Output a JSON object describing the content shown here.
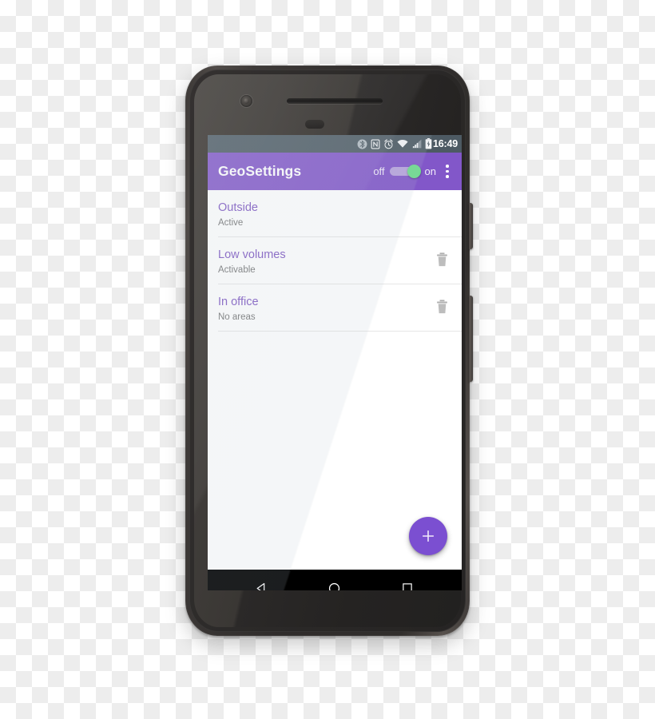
{
  "device": {
    "name": "android-smartphone",
    "hardware": {
      "front_camera": "front-camera",
      "earpiece": "earpiece-speaker",
      "proximity_sensor": "proximity-sensor",
      "power_button": "power-button",
      "volume_button": "volume-rocker"
    }
  },
  "status_bar": {
    "clock": "16:49",
    "background": "#4d5a63",
    "icons": [
      "bluetooth-icon",
      "nfc-icon",
      "alarm-icon",
      "wifi-icon",
      "cellular-signal-icon",
      "battery-icon"
    ]
  },
  "app_bar": {
    "title": "GeoSettings",
    "background": "#8257c9",
    "switch": {
      "off_label": "off",
      "on_label": "on",
      "state": "on",
      "thumb_color": "#6ddc8c",
      "track_color": "#b9a4dd"
    },
    "overflow_label": "overflow-menu"
  },
  "list": {
    "items": [
      {
        "title": "Outside",
        "subtitle": "Active",
        "deletable": false
      },
      {
        "title": "Low volumes",
        "subtitle": "Activable",
        "deletable": true
      },
      {
        "title": "In office",
        "subtitle": "No areas",
        "deletable": true
      }
    ],
    "title_color": "#7e57c2",
    "subtitle_color": "#757575",
    "divider_color": "#e6e6e6"
  },
  "fab": {
    "label": "+",
    "name": "add-geofence-fab",
    "color": "#7b4fd1"
  },
  "nav_bar": {
    "background": "#000000",
    "buttons": [
      "back-button",
      "home-button",
      "recents-button"
    ]
  }
}
